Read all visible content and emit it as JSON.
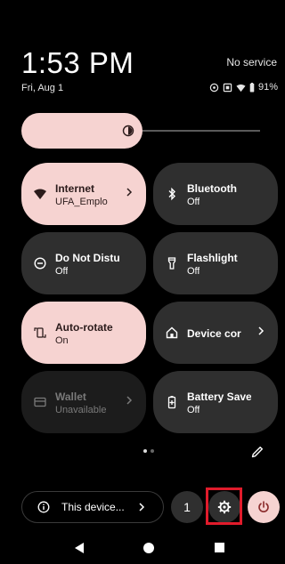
{
  "status": {
    "time": "1:53 PM",
    "service": "No service",
    "date": "Fri, Aug 1",
    "battery": "91%"
  },
  "brightness": {
    "level_percent": 50
  },
  "tiles": [
    {
      "title": "Internet",
      "subtitle": "UFA_Emplo",
      "state": "on",
      "icon": "wifi-icon",
      "chevron": true
    },
    {
      "title": "Bluetooth",
      "subtitle": "Off",
      "state": "off",
      "icon": "bluetooth-icon",
      "chevron": false
    },
    {
      "title": "Do Not Distur",
      "subtitle": "Off",
      "state": "off",
      "icon": "dnd-icon",
      "chevron": false
    },
    {
      "title": "Flashlight",
      "subtitle": "Off",
      "state": "off",
      "icon": "flashlight-icon",
      "chevron": false
    },
    {
      "title": "Auto-rotate",
      "subtitle": "On",
      "state": "on",
      "icon": "rotate-icon",
      "chevron": false
    },
    {
      "title": "Device cor",
      "subtitle": "",
      "state": "off",
      "icon": "home-icon",
      "chevron": true
    },
    {
      "title": "Wallet",
      "subtitle": "Unavailable",
      "state": "dim",
      "icon": "wallet-icon",
      "chevron": true
    },
    {
      "title": "Battery Saver",
      "subtitle": "Off",
      "state": "off",
      "icon": "battery-saver-icon",
      "chevron": false
    }
  ],
  "footer": {
    "device_label": "This device...",
    "count": "1"
  },
  "colors": {
    "accent": "#f6d3d1",
    "tile": "#2f2f2f",
    "highlight": "#e01b2b"
  }
}
